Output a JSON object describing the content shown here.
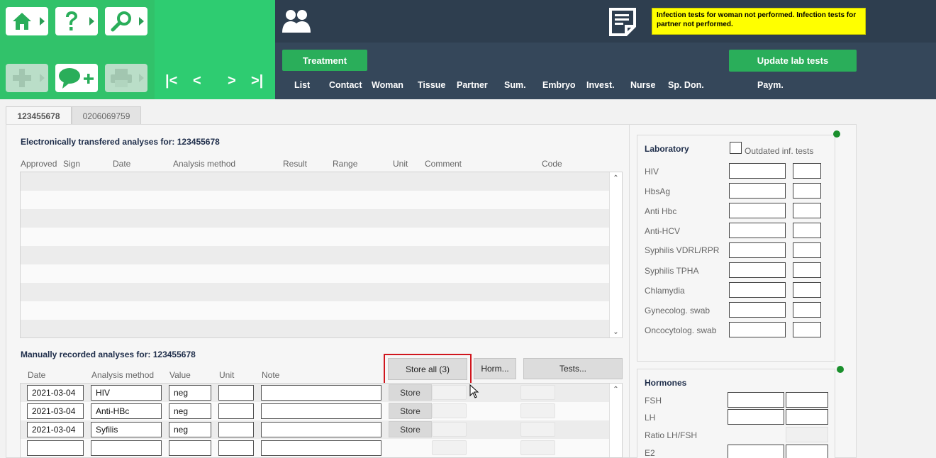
{
  "toolbar": {
    "buttons": [
      {
        "name": "home",
        "icon": "home-icon"
      },
      {
        "name": "help",
        "icon": "question-icon"
      },
      {
        "name": "search",
        "icon": "search-icon"
      },
      {
        "name": "add",
        "icon": "plus-icon"
      },
      {
        "name": "message",
        "icon": "speech-bubble-plus-icon"
      },
      {
        "name": "print",
        "icon": "printer-icon"
      }
    ],
    "nav": {
      "first": "|<",
      "prev": "<",
      "next": ">",
      "last": ">|"
    }
  },
  "header": {
    "alert_text": "Infection tests for woman not performed. Infection tests for partner not performed.",
    "treatment_label": "Treatment",
    "update_lab_label": "Update lab tests",
    "menu": [
      "List",
      "Contact",
      "Woman",
      "Tissue",
      "Partner",
      "Sum.",
      "Embryo",
      "Invest.",
      "Nurse",
      "Sp. Don.",
      "Paym."
    ]
  },
  "tabs": [
    "123455678",
    "0206069759"
  ],
  "electronic": {
    "title": "Electronically transfered analyses for: 123455678",
    "columns": [
      "Approved",
      "Sign",
      "Date",
      "Analysis method",
      "Result",
      "Range",
      "Unit",
      "Comment",
      "Code"
    ]
  },
  "manual": {
    "title": "Manually recorded analyses for: 123455678",
    "store_all_label": "Store all (3)",
    "horm_label": "Horm...",
    "tests_label": "Tests...",
    "columns": [
      "Date",
      "Analysis method",
      "Value",
      "Unit",
      "Note"
    ],
    "store_label": "Store",
    "rows": [
      {
        "date": "2021-03-04",
        "method": "HIV",
        "value": "neg",
        "unit": "",
        "note": ""
      },
      {
        "date": "2021-03-04",
        "method": "Anti-HBc",
        "value": "neg",
        "unit": "",
        "note": ""
      },
      {
        "date": "2021-03-04",
        "method": "Syfilis",
        "value": "neg",
        "unit": "",
        "note": ""
      },
      {
        "date": "",
        "method": "",
        "value": "",
        "unit": "",
        "note": ""
      }
    ]
  },
  "laboratory": {
    "title": "Laboratory",
    "outdated_label": "Outdated inf. tests",
    "tests": [
      "HIV",
      "HbsAg",
      "Anti Hbc",
      "Anti-HCV",
      "Syphilis VDRL/RPR",
      "Syphilis TPHA",
      "Chlamydia",
      "Gynecolog. swab",
      "Oncocytolog. swab"
    ]
  },
  "hormones": {
    "title": "Hormones",
    "items": [
      "FSH",
      "LH",
      "Ratio LH/FSH",
      "E2"
    ]
  },
  "colors": {
    "green": "#2ecc71",
    "dark_header": "#2e3e4f",
    "alert_yellow": "#ffff00",
    "highlight_red": "#d0161e",
    "status_dot": "#1a8f2c"
  }
}
